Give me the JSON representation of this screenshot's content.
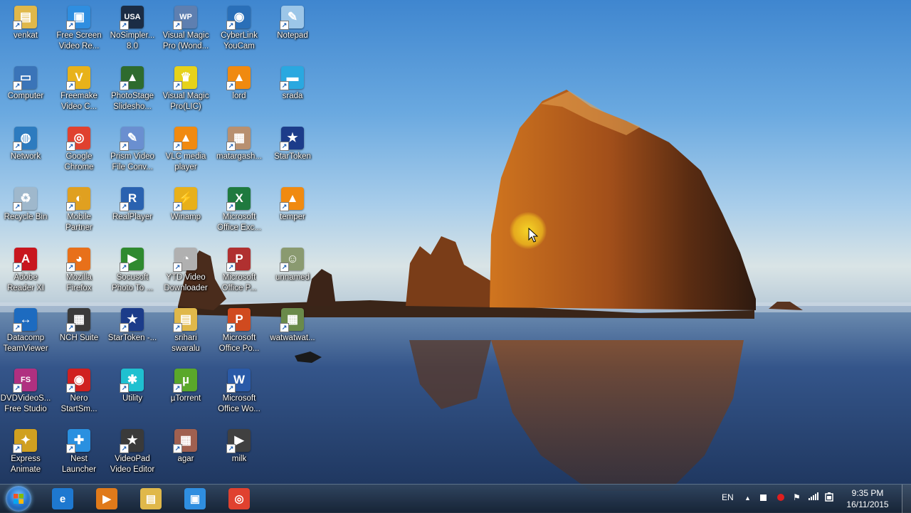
{
  "desktop_icons": [
    {
      "label": "venkat",
      "name": "folder-icon",
      "col": 0,
      "row": 0,
      "color": "#e0b84a",
      "glyph": "▤"
    },
    {
      "label": "Free Screen\nVideo Re...",
      "name": "screen-recorder-icon",
      "col": 1,
      "row": 0,
      "color": "#2f8ee0",
      "glyph": "▣"
    },
    {
      "label": "NoSimpler...\n8.0",
      "name": "nosimpler-icon",
      "col": 2,
      "row": 0,
      "color": "#1b2c44",
      "glyph": "USA"
    },
    {
      "label": "Visual Magic\nPro (Wond...",
      "name": "wp-icon",
      "col": 3,
      "row": 0,
      "color": "#5e7fb0",
      "glyph": "WP"
    },
    {
      "label": "CyberLink\nYouCam",
      "name": "youcam-icon",
      "col": 4,
      "row": 0,
      "color": "#2a6fb8",
      "glyph": "◉"
    },
    {
      "label": "Notepad",
      "name": "notepad-icon",
      "col": 5,
      "row": 0,
      "color": "#9cc6e8",
      "glyph": "✎"
    },
    {
      "label": "Computer",
      "name": "computer-icon",
      "col": 0,
      "row": 1,
      "color": "#3a74b8",
      "glyph": "▭"
    },
    {
      "label": "Freemake\nVideo C...",
      "name": "freemake-icon",
      "col": 1,
      "row": 1,
      "color": "#e8b21a",
      "glyph": "V"
    },
    {
      "label": "PhotoStage\nSlidesho...",
      "name": "photostage-icon",
      "col": 2,
      "row": 1,
      "color": "#2e6b2e",
      "glyph": "▲"
    },
    {
      "label": "Visual Magic\nPro(LIC)",
      "name": "visual-magic-lic-icon",
      "col": 3,
      "row": 1,
      "color": "#e6d21a",
      "glyph": "♛"
    },
    {
      "label": "lord",
      "name": "vlc-cone-icon",
      "col": 4,
      "row": 1,
      "color": "#f08a10",
      "glyph": "▲"
    },
    {
      "label": "srada",
      "name": "srada-icon",
      "col": 5,
      "row": 1,
      "color": "#2aa8e0",
      "glyph": "▬"
    },
    {
      "label": "Network",
      "name": "network-icon",
      "col": 0,
      "row": 2,
      "color": "#2d7bbf",
      "glyph": "◍"
    },
    {
      "label": "Google\nChrome",
      "name": "chrome-icon",
      "col": 1,
      "row": 2,
      "color": "#e0412f",
      "glyph": "◎"
    },
    {
      "label": "Prism Video\nFile Conv...",
      "name": "prism-icon",
      "col": 2,
      "row": 2,
      "color": "#6a8fd0",
      "glyph": "✎"
    },
    {
      "label": "VLC media\nplayer",
      "name": "vlc-icon",
      "col": 3,
      "row": 2,
      "color": "#f08a10",
      "glyph": "▲"
    },
    {
      "label": "matargash...",
      "name": "photo-icon",
      "col": 4,
      "row": 2,
      "color": "#b89070",
      "glyph": "▦"
    },
    {
      "label": "StarToken",
      "name": "startoken-icon",
      "col": 5,
      "row": 2,
      "color": "#1c3c8a",
      "glyph": "★"
    },
    {
      "label": "Recycle Bin",
      "name": "recycle-bin-icon",
      "col": 0,
      "row": 3,
      "color": "#9fb8cc",
      "glyph": "♻"
    },
    {
      "label": "Mobile\nPartner",
      "name": "mobile-partner-icon",
      "col": 1,
      "row": 3,
      "color": "#e0a020",
      "glyph": "◐"
    },
    {
      "label": "RealPlayer",
      "name": "realplayer-icon",
      "col": 2,
      "row": 3,
      "color": "#2a62b0",
      "glyph": "R"
    },
    {
      "label": "Winamp",
      "name": "winamp-icon",
      "col": 3,
      "row": 3,
      "color": "#e8b01a",
      "glyph": "⚡"
    },
    {
      "label": "Microsoft\nOffice Exc...",
      "name": "excel-icon",
      "col": 4,
      "row": 3,
      "color": "#1f7a3f",
      "glyph": "X"
    },
    {
      "label": "temper",
      "name": "temper-vlc-icon",
      "col": 5,
      "row": 3,
      "color": "#f08a10",
      "glyph": "▲"
    },
    {
      "label": "Adobe\nReader XI",
      "name": "adobe-reader-icon",
      "col": 0,
      "row": 4,
      "color": "#c8161e",
      "glyph": "A"
    },
    {
      "label": "Mozilla\nFirefox",
      "name": "firefox-icon",
      "col": 1,
      "row": 4,
      "color": "#e8701a",
      "glyph": "◕"
    },
    {
      "label": "Socusoft\nPhoto To ...",
      "name": "socusoft-icon",
      "col": 2,
      "row": 4,
      "color": "#2f8a2f",
      "glyph": "▶"
    },
    {
      "label": "YTD Video\nDownloader",
      "name": "ytd-icon",
      "col": 3,
      "row": 4,
      "color": "#b0b0b0",
      "glyph": "◔"
    },
    {
      "label": "Microsoft\nOffice P...",
      "name": "publisher-icon",
      "col": 4,
      "row": 4,
      "color": "#b03030",
      "glyph": "P"
    },
    {
      "label": "unnamed",
      "name": "unnamed-icon",
      "col": 5,
      "row": 4,
      "color": "#8a9a70",
      "glyph": "☺"
    },
    {
      "label": "Datacomp\nTeamViewer",
      "name": "teamviewer-icon",
      "col": 0,
      "row": 5,
      "color": "#1d6bc0",
      "glyph": "↔"
    },
    {
      "label": "NCH Suite",
      "name": "nch-suite-icon",
      "col": 1,
      "row": 5,
      "color": "#3a3a3a",
      "glyph": "▦"
    },
    {
      "label": "StarToken -...",
      "name": "startoken-2-icon",
      "col": 2,
      "row": 5,
      "color": "#1c3c8a",
      "glyph": "★"
    },
    {
      "label": "srihari\nswaralu",
      "name": "folder-2-icon",
      "col": 3,
      "row": 5,
      "color": "#e0b84a",
      "glyph": "▤"
    },
    {
      "label": "Microsoft\nOffice Po...",
      "name": "powerpoint-icon",
      "col": 4,
      "row": 5,
      "color": "#d04a1f",
      "glyph": "P"
    },
    {
      "label": "watwatwat...",
      "name": "photo-2-icon",
      "col": 5,
      "row": 5,
      "color": "#6a8a4a",
      "glyph": "▦"
    },
    {
      "label": "DVDVideoS...\nFree Studio",
      "name": "dvdvideosoft-icon",
      "col": 0,
      "row": 6,
      "color": "#b03080",
      "glyph": "FS"
    },
    {
      "label": "Nero\nStartSm...",
      "name": "nero-icon",
      "col": 1,
      "row": 6,
      "color": "#d02020",
      "glyph": "◉"
    },
    {
      "label": "Utility",
      "name": "utility-icon",
      "col": 2,
      "row": 6,
      "color": "#1fc0d0",
      "glyph": "✱"
    },
    {
      "label": "µTorrent",
      "name": "utorrent-icon",
      "col": 3,
      "row": 6,
      "color": "#5aa82a",
      "glyph": "µ"
    },
    {
      "label": "Microsoft\nOffice Wo...",
      "name": "word-icon",
      "col": 4,
      "row": 6,
      "color": "#2a5aa8",
      "glyph": "W"
    },
    {
      "label": "Express\nAnimate",
      "name": "express-animate-icon",
      "col": 0,
      "row": 7,
      "color": "#d0a020",
      "glyph": "✦"
    },
    {
      "label": "Nest\nLauncher",
      "name": "nest-launcher-icon",
      "col": 1,
      "row": 7,
      "color": "#2a90e0",
      "glyph": "✚"
    },
    {
      "label": "VideoPad\nVideo Editor",
      "name": "videopad-icon",
      "col": 2,
      "row": 7,
      "color": "#3a3a3a",
      "glyph": "★"
    },
    {
      "label": "agar",
      "name": "agar-photo-icon",
      "col": 3,
      "row": 7,
      "color": "#a06050",
      "glyph": "▦"
    },
    {
      "label": "milk",
      "name": "milk-video-icon",
      "col": 4,
      "row": 7,
      "color": "#404040",
      "glyph": "▶"
    }
  ],
  "taskbar": {
    "pinned": [
      {
        "name": "internet-explorer-icon",
        "color": "#1e78d0",
        "glyph": "e"
      },
      {
        "name": "media-player-icon",
        "color": "#e07a1a",
        "glyph": "▶"
      },
      {
        "name": "file-explorer-icon",
        "color": "#e0b84a",
        "glyph": "▤"
      },
      {
        "name": "screen-recorder-taskbar-icon",
        "color": "#2f8ee0",
        "glyph": "▣"
      },
      {
        "name": "chrome-taskbar-icon",
        "color": "#e0412f",
        "glyph": "◎"
      }
    ],
    "language": "EN",
    "time": "9:35 PM",
    "date": "16/11/2015"
  }
}
